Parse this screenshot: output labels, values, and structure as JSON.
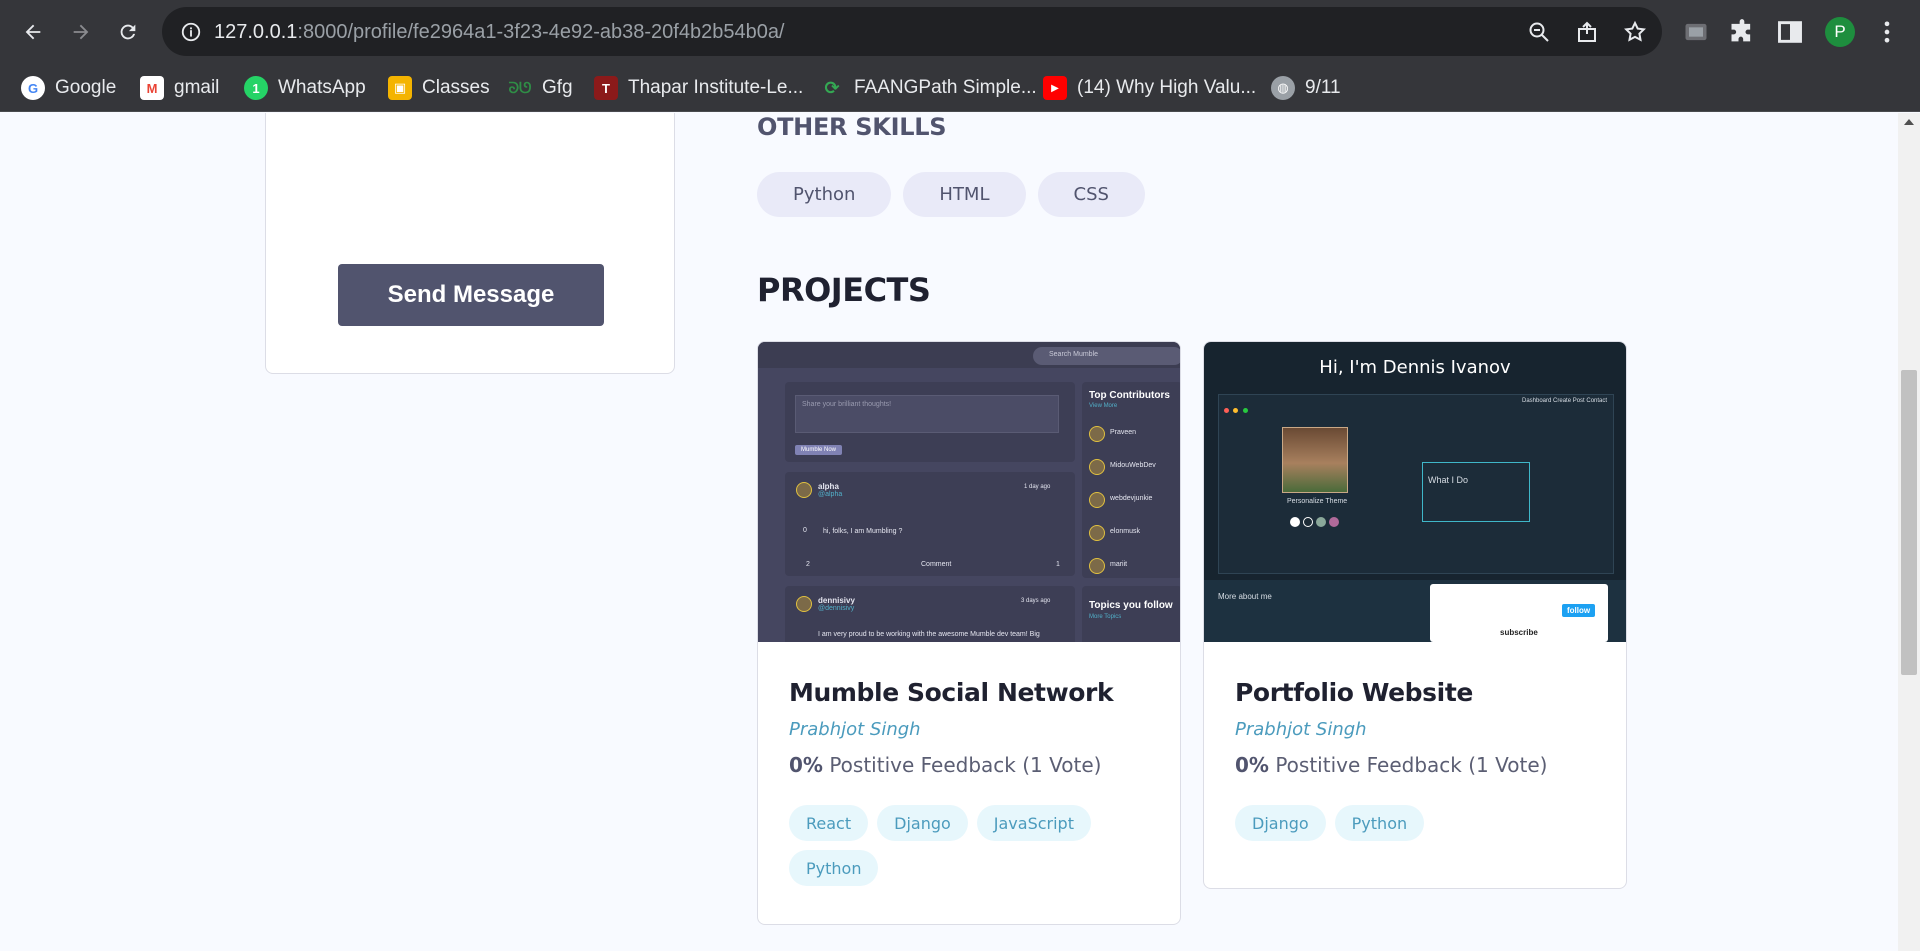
{
  "browser": {
    "url_host": "127.0.0.1",
    "url_rest": ":8000/profile/fe2964a1-3f23-4e92-ab38-20f4b2b54b0a/",
    "profile_initial": "P",
    "bookmarks": [
      {
        "label": "Google",
        "icon": "google-icon"
      },
      {
        "label": "gmail",
        "icon": "gmail-icon"
      },
      {
        "label": "WhatsApp",
        "icon": "whatsapp-icon"
      },
      {
        "label": "Classes",
        "icon": "classroom-icon"
      },
      {
        "label": "Gfg",
        "icon": "gfg-icon"
      },
      {
        "label": "Thapar Institute-Le...",
        "icon": "thapar-icon"
      },
      {
        "label": "FAANGPath Simple...",
        "icon": "faangpath-icon"
      },
      {
        "label": "(14) Why High Valu...",
        "icon": "youtube-icon"
      },
      {
        "label": "9/11",
        "icon": "globe-icon"
      }
    ]
  },
  "contact": {
    "send_label": "Send Message"
  },
  "skills": {
    "heading": "OTHER SKILLS",
    "items": [
      "Python",
      "HTML",
      "CSS"
    ]
  },
  "projects": {
    "heading": "PROJECTS",
    "items": [
      {
        "title": "Mumble Social Network",
        "author": "Prabhjot Singh",
        "feedback_pct": "0%",
        "feedback_text": "Postitive Feedback (1 Vote)",
        "tags": [
          "React",
          "Django",
          "JavaScript",
          "Python"
        ],
        "thumb": {
          "search": "Search Mumble",
          "input_placeholder": "Share your brilliant thoughts!",
          "mumble_now": "Mumble Now",
          "top_contributors": "Top Contributors",
          "view_more": "View More",
          "contributors": [
            "Praveen",
            "MidouWebDev",
            "webdevjunkie",
            "elonmusk",
            "mariit"
          ],
          "post1_user": "alpha",
          "post1_handle": "@alpha",
          "post1_time": "1 day ago",
          "post1_text": "hi, folks, I am Mumbling ?",
          "post1_votes": "0",
          "post1_comments": "2",
          "post1_comment_label": "Comment",
          "post1_shares": "1",
          "post2_user": "dennisivy",
          "post2_handle": "@dennisivy",
          "post2_time": "3 days ago",
          "post2_text": "I am very proud to be working with the awesome Mumble dev team! Big",
          "topics": "Topics you follow",
          "more_topics": "More Topics"
        }
      },
      {
        "title": "Portfolio Website",
        "author": "Prabhjot Singh",
        "feedback_pct": "0%",
        "feedback_text": "Postitive Feedback (1 Vote)",
        "tags": [
          "Django",
          "Python"
        ],
        "thumb": {
          "hero": "Hi, I'm Dennis Ivanov",
          "nav": "Dashboard   Create Post   Contact",
          "personalize": "Personalize Theme",
          "what_i_do": "What I Do",
          "more_about": "More about me",
          "follow": "follow",
          "subscribe": "subscribe"
        }
      }
    ]
  }
}
